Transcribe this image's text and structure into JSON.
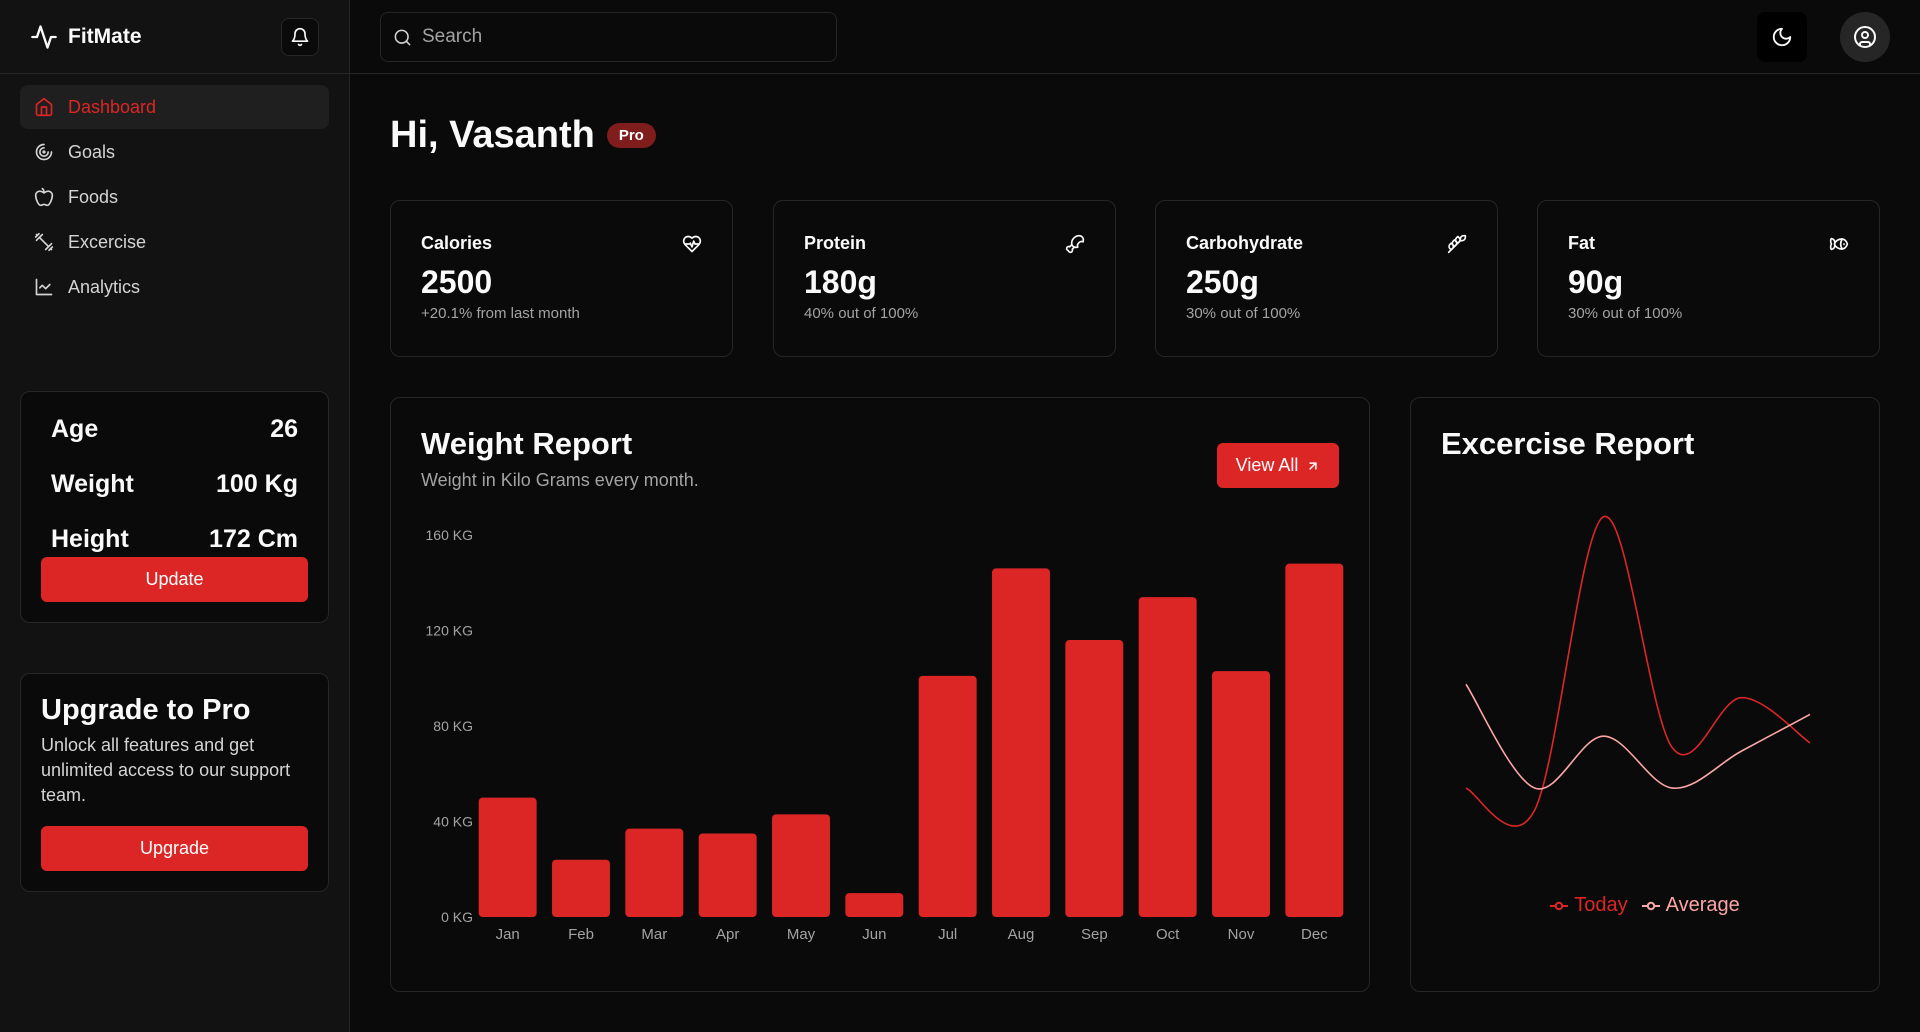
{
  "app": {
    "name": "FitMate"
  },
  "sidebar": {
    "items": [
      {
        "label": "Dashboard",
        "icon": "home-icon",
        "active": true
      },
      {
        "label": "Goals",
        "icon": "goals-icon"
      },
      {
        "label": "Foods",
        "icon": "apple-icon"
      },
      {
        "label": "Excercise",
        "icon": "dumbbell-icon"
      },
      {
        "label": "Analytics",
        "icon": "line-chart-icon"
      }
    ]
  },
  "profile_stats": {
    "age_label": "Age",
    "age_value": "26",
    "weight_label": "Weight",
    "weight_value": "100 Kg",
    "height_label": "Height",
    "height_value": "172 Cm",
    "update_label": "Update"
  },
  "upgrade": {
    "title": "Upgrade to Pro",
    "text": "Unlock all features and get unlimited access to our support team.",
    "button": "Upgrade"
  },
  "header": {
    "search_placeholder": "Search"
  },
  "greeting": {
    "text": "Hi, Vasanth",
    "badge": "Pro"
  },
  "metrics": [
    {
      "title": "Calories",
      "value": "2500",
      "sub": "+20.1% from last month",
      "icon": "heart-pulse-icon"
    },
    {
      "title": "Protein",
      "value": "180g",
      "sub": "40% out of 100%",
      "icon": "drumstick-icon"
    },
    {
      "title": "Carbohydrate",
      "value": "250g",
      "sub": "30% out of 100%",
      "icon": "wheat-icon"
    },
    {
      "title": "Fat",
      "value": "90g",
      "sub": "30% out of 100%",
      "icon": "fish-icon"
    }
  ],
  "weight_report": {
    "title": "Weight Report",
    "subtitle": "Weight in Kilo Grams every month.",
    "view_all": "View All"
  },
  "exercise_report": {
    "title": "Excercise Report"
  },
  "colors": {
    "accent": "#dc2626",
    "today": "#dc2626",
    "average": "#fca5a5"
  },
  "chart_data": [
    {
      "type": "bar",
      "categories": [
        "Jan",
        "Feb",
        "Mar",
        "Apr",
        "May",
        "Jun",
        "Jul",
        "Aug",
        "Sep",
        "Oct",
        "Nov",
        "Dec"
      ],
      "values": [
        50,
        24,
        37,
        35,
        43,
        10,
        101,
        146,
        116,
        134,
        103,
        148
      ],
      "ylim": [
        0,
        160
      ],
      "yticks": [
        0,
        40,
        80,
        120,
        160
      ],
      "ytick_labels": [
        "0 KG",
        "40 KG",
        "80 KG",
        "120 KG",
        "160 KG"
      ],
      "grid": false
    },
    {
      "type": "line",
      "x": [
        0,
        1,
        2,
        3,
        4,
        5
      ],
      "series": [
        {
          "name": "Today",
          "values": [
            28,
            15,
            190,
            52,
            82,
            55
          ]
        },
        {
          "name": "Average",
          "values": [
            90,
            28,
            59,
            28,
            50,
            72
          ]
        }
      ],
      "legend": "bottom",
      "grid": false
    }
  ]
}
